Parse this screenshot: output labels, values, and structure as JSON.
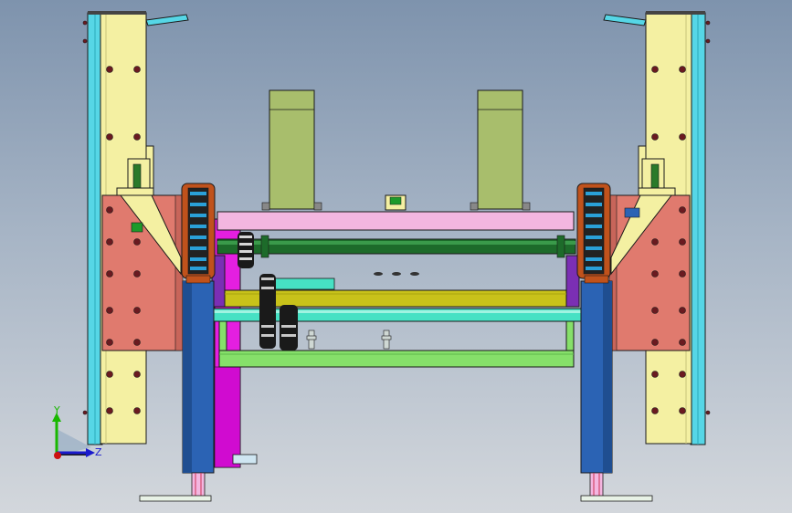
{
  "view": {
    "background_top": "#7e93ad",
    "background_bottom": "#d3d7dc"
  },
  "triad": {
    "y_label": "Y",
    "z_label": "Z",
    "y_color": "#19b800",
    "z_color": "#1a1acc",
    "x_color": "#cc1111"
  },
  "colors": {
    "column_yellow": "#f4f0a2",
    "column_cyan": "#56d6e6",
    "bracket_salmon": "#e07a6e",
    "pink_beam": "#f3b6e0",
    "magenta_bar": "#e41fe0",
    "green_shaft": "#1d6b2a",
    "olive_beam": "#c8c21a",
    "teal_shaft": "#46e1c4",
    "lime_frame": "#86e06a",
    "blue_post": "#2b63b4",
    "sprocket_brown": "#c0521c",
    "purple_plate": "#7b2fb4",
    "cylinder_olive": "#a8be6c"
  },
  "icons": [
    "coordinate-triad-icon"
  ]
}
